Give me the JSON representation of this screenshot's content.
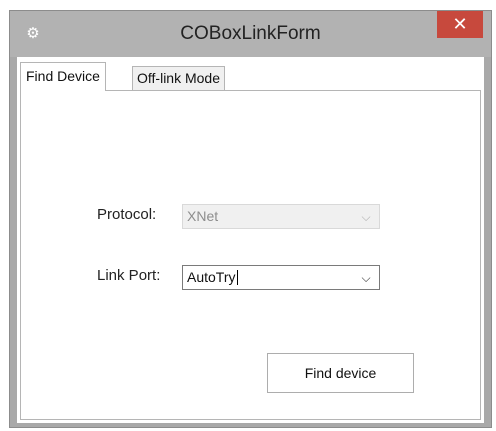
{
  "window": {
    "title": "COBoxLinkForm",
    "icon": "gear-icon",
    "close_icon": "close-icon"
  },
  "tabs": [
    {
      "label": "Find Device",
      "active": true
    },
    {
      "label": "Off-link Mode",
      "active": false
    }
  ],
  "form": {
    "protocol_label": "Protocol:",
    "protocol_value": "XNet",
    "protocol_enabled": false,
    "link_port_label": "Link Port:",
    "link_port_value": "AutoTry",
    "find_button_label": "Find device"
  },
  "colors": {
    "titlebar": "#b2b2b2",
    "close_button": "#c7493d"
  }
}
